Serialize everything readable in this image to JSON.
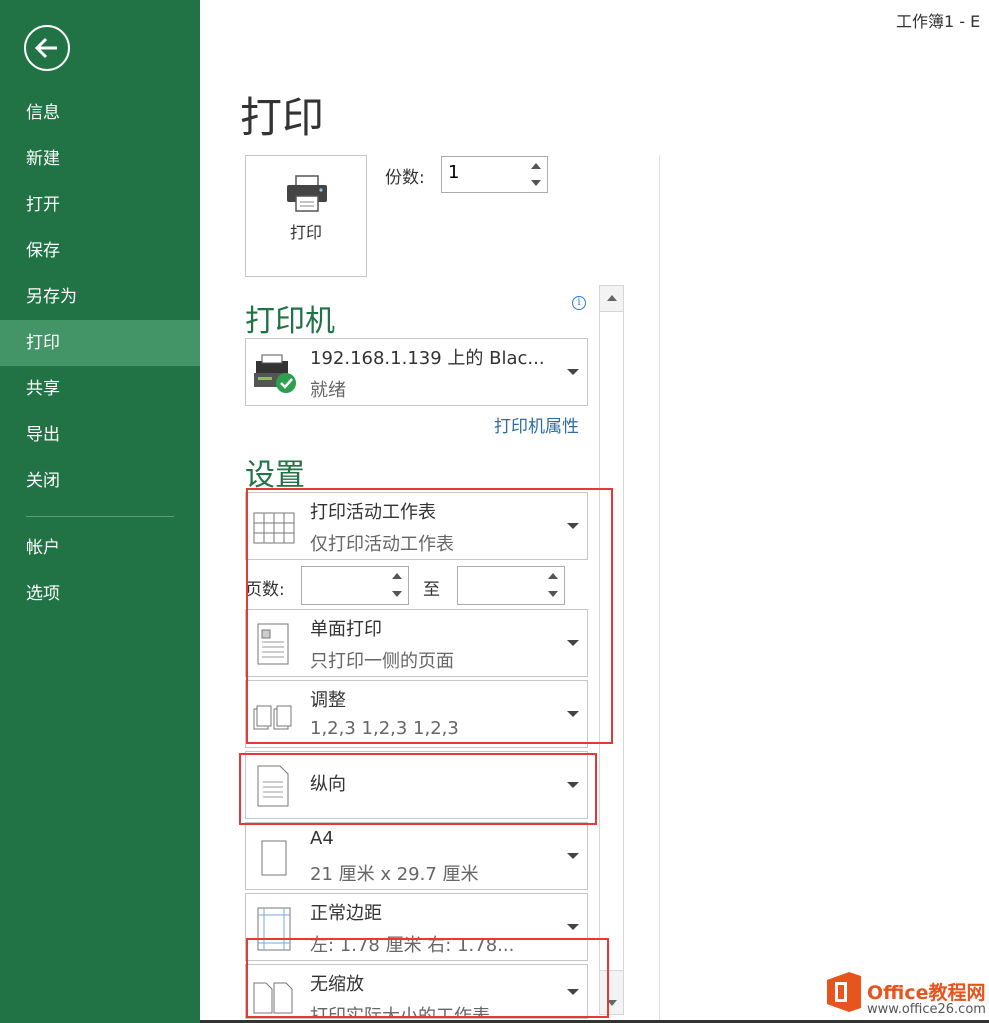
{
  "window": {
    "title": "工作簿1 - E"
  },
  "nav": {
    "items": [
      {
        "label": "信息"
      },
      {
        "label": "新建"
      },
      {
        "label": "打开"
      },
      {
        "label": "保存"
      },
      {
        "label": "另存为"
      },
      {
        "label": "打印"
      },
      {
        "label": "共享"
      },
      {
        "label": "导出"
      },
      {
        "label": "关闭"
      },
      {
        "label": "帐户"
      },
      {
        "label": "选项"
      }
    ],
    "active": "打印"
  },
  "page": {
    "title": "打印"
  },
  "print_button": {
    "label": "打印"
  },
  "copies": {
    "label": "份数:",
    "value": "1"
  },
  "printer": {
    "section_title": "打印机",
    "name": "192.168.1.139 上的 Blac...",
    "status": "就绪",
    "properties_link": "打印机属性"
  },
  "settings": {
    "section_title": "设置",
    "what": {
      "main": "打印活动工作表",
      "sub": "仅打印活动工作表"
    },
    "pages": {
      "label": "页数:",
      "to_label": "至",
      "from": "",
      "to": ""
    },
    "sides": {
      "main": "单面打印",
      "sub": "只打印一侧的页面"
    },
    "collate": {
      "main": "调整",
      "sub": "1,2,3    1,2,3    1,2,3"
    },
    "orientation": {
      "main": "纵向",
      "sub": ""
    },
    "paper": {
      "main": "A4",
      "sub": "21 厘米 x 29.7 厘米"
    },
    "margins": {
      "main": "正常边距",
      "sub": "左:  1.78 厘米    右:  1.78..."
    },
    "scaling": {
      "main": "无缩放",
      "sub": "打印实际大小的工作表"
    }
  },
  "watermark": {
    "line1": "Office教程网",
    "line2": "www.office26.com"
  },
  "colors": {
    "sidebar": "#217346",
    "sidebar_active": "#439467",
    "accent_green": "#217346",
    "link_blue": "#2e6da4",
    "highlight_red": "#e53935"
  }
}
